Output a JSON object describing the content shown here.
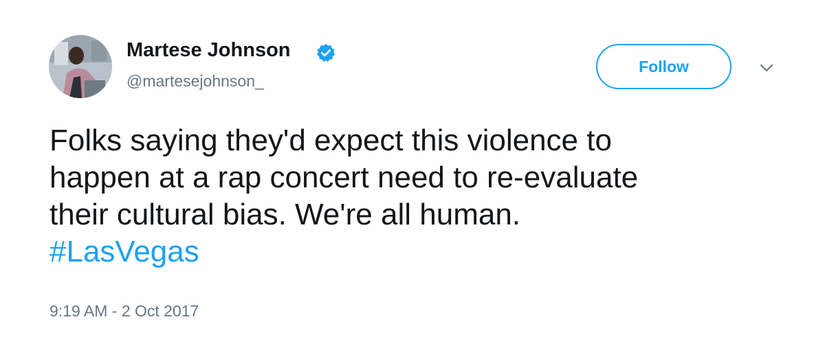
{
  "author": {
    "display_name": "Martese Johnson",
    "handle": "@martesejohnson_",
    "verified": true,
    "avatar_icon": "profile-photo"
  },
  "actions": {
    "follow_label": "Follow",
    "menu_icon": "chevron-down-icon"
  },
  "tweet": {
    "lines": [
      "Folks saying they'd expect this violence to",
      "happen at a rap concert need to re-evaluate",
      "their cultural bias. We're all human."
    ],
    "hashtag": "#LasVegas",
    "timestamp": "9:19 AM - 2 Oct 2017"
  },
  "colors": {
    "accent": "#1da1f2",
    "text": "#14171a",
    "secondary_text": "#657786",
    "background": "#ffffff"
  }
}
